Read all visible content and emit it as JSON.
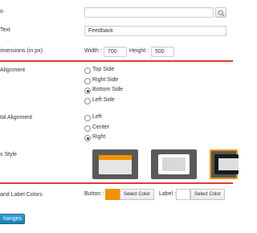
{
  "form": {
    "row_image_label": "o",
    "row_text_label": "Text",
    "text_value": "Feedback",
    "row_dimensions_label": "imensions (in px)",
    "width_label": "Width :",
    "width_value": "700",
    "height_label": "Height :",
    "height_value": "500",
    "vertical_alignment_label": " Alignment",
    "vertical_options": [
      {
        "label": "Top Side",
        "checked": false
      },
      {
        "label": "Right Side",
        "checked": false
      },
      {
        "label": "Bottom Side",
        "checked": true
      },
      {
        "label": "Left Side",
        "checked": false
      }
    ],
    "horizontal_alignment_label": "tal Alignment",
    "horizontal_options": [
      {
        "label": "Left",
        "checked": false
      },
      {
        "label": "Center",
        "checked": false
      },
      {
        "label": "Right",
        "checked": true
      }
    ],
    "box_style_label": "x Style",
    "box_styles": [
      {
        "name": "top-bar-style",
        "selected": false
      },
      {
        "name": "light-frame-style",
        "selected": false
      },
      {
        "name": "dark-frame-style",
        "selected": true
      }
    ],
    "colors_label": "and Label Colors",
    "button_color_label": "Button :",
    "button_color": "#f39200",
    "select_color_label": "Select Color",
    "label_color_label": "Label :",
    "label_color": "#ffffff",
    "save_label": "hanges"
  },
  "colors": {
    "accent_red": "#e03a36",
    "save_blue": "#1f8dc6",
    "selected_border": "#f39200",
    "style_bg": "#555555"
  },
  "icons": {
    "search": "magnifier-icon"
  }
}
